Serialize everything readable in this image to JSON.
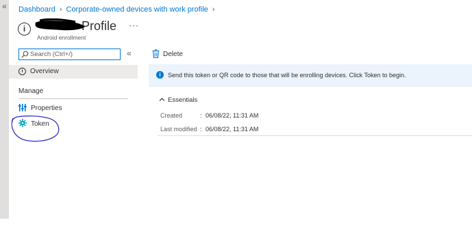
{
  "rail": {
    "collapse_glyph": "«"
  },
  "breadcrumb": {
    "items": [
      "Dashboard",
      "Corporate-owned devices with work profile"
    ],
    "separator": "›"
  },
  "header": {
    "title": "Profile",
    "subtitle": "Android enrollment",
    "more": "···",
    "info_icon": "i"
  },
  "sidebar": {
    "search": {
      "placeholder": "Search (Ctrl+/)",
      "value": ""
    },
    "collapse_glyph": "«",
    "overview": {
      "label": "Overview",
      "icon": "info-circle-icon"
    },
    "section": "Manage",
    "items": [
      {
        "label": "Properties",
        "icon": "properties-icon"
      },
      {
        "label": "Token",
        "icon": "gear-icon"
      }
    ]
  },
  "toolbar": {
    "delete_label": "Delete"
  },
  "info_bar": {
    "text": "Send this token or QR code to those that will be enrolling devices. Click Token to begin.",
    "icon_glyph": "i"
  },
  "essentials": {
    "label": "Essentials",
    "rows": [
      {
        "key": "Created",
        "value": "06/08/22, 11:31 AM"
      },
      {
        "key": "Last modified",
        "value": "06/08/22, 11:31 AM"
      }
    ]
  },
  "colors": {
    "accent": "#0078d4",
    "annotation": "#3333cc",
    "selected_bg": "#edebe9",
    "info_bg": "#ebf3fc"
  }
}
